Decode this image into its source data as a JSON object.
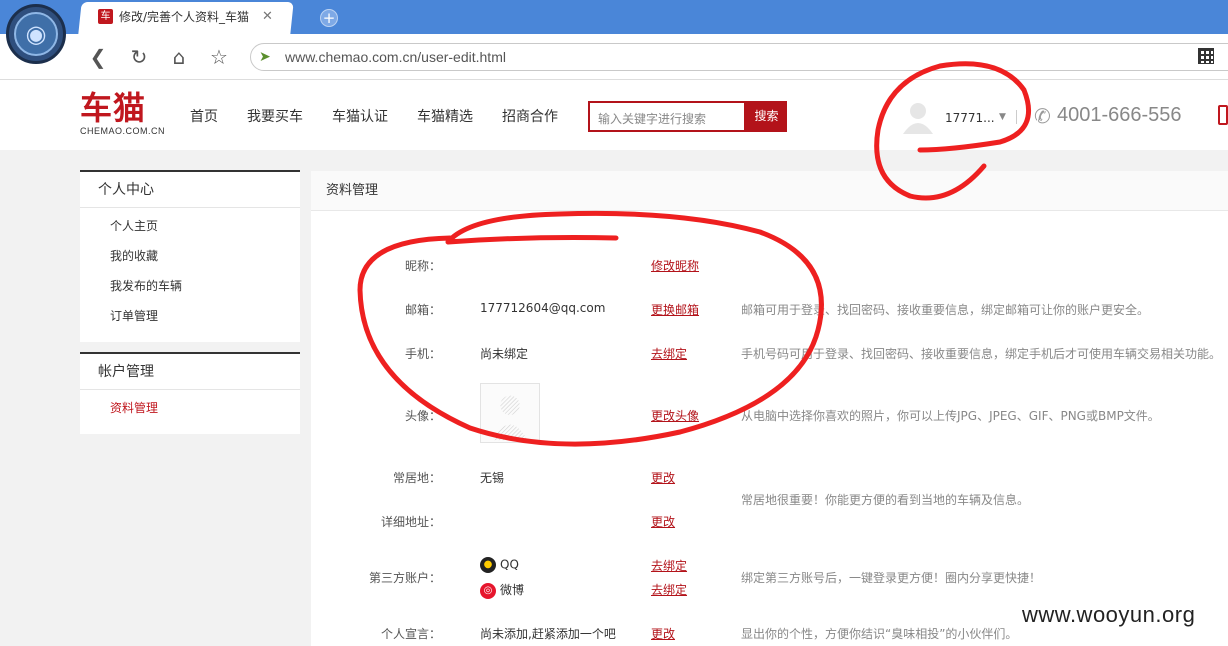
{
  "browser": {
    "tab_title": "修改/完善个人资料_车猫",
    "tab_favicon": "车",
    "url": "www.chemao.com.cn/user-edit.html",
    "icons": [
      "browser-logo-icon",
      "back-icon",
      "reload-icon",
      "home-icon",
      "bookmark-star-icon",
      "qr-code-icon"
    ]
  },
  "header": {
    "logo_cn": "车猫",
    "logo_en": "CHEMAO.COM.CN",
    "nav": [
      "首页",
      "我要买车",
      "车猫认证",
      "车猫精选",
      "招商合作"
    ],
    "search_placeholder": "输入关键字进行搜索",
    "search_button": "搜索",
    "username": "17771...",
    "phone": "4001-666-556"
  },
  "sidebar": {
    "sections": [
      {
        "title": "个人中心",
        "items": [
          "个人主页",
          "我的收藏",
          "我发布的车辆",
          "订单管理"
        ]
      },
      {
        "title": "帐户管理",
        "items": [
          "资料管理"
        ]
      }
    ]
  },
  "main": {
    "title": "资料管理",
    "rows": {
      "nickname": {
        "label": "昵称：",
        "value": "",
        "link": "修改昵称"
      },
      "email": {
        "label": "邮箱：",
        "value": "177712604@qq.com",
        "link": "更换邮箱",
        "hint": "邮箱可用于登录、找回密码、接收重要信息，绑定邮箱可让你的账户更安全。"
      },
      "phone": {
        "label": "手机：",
        "value": "尚未绑定",
        "link": "去绑定",
        "hint": "手机号码可用于登录、找回密码、接收重要信息，绑定手机后才可使用车辆交易相关功能。"
      },
      "avatar": {
        "label": "头像：",
        "link": "更改头像",
        "hint": "从电脑中选择你喜欢的照片，你可以上传JPG、JPEG、GIF、PNG或BMP文件。"
      },
      "residence": {
        "label": "常居地：",
        "value": "无锡",
        "link": "更改"
      },
      "address": {
        "label": "详细地址：",
        "value": "",
        "link": "更改",
        "hint": "常居地很重要！你能更方便的看到当地的车辆及信息。"
      },
      "third_party": {
        "label": "第三方账户：",
        "qq": "QQ",
        "qq_link": "去绑定",
        "weibo": "微博",
        "weibo_link": "去绑定",
        "hint": "绑定第三方账号后，一键登录更方便！圈内分享更快捷！"
      },
      "motto": {
        "label": "个人宣言：",
        "value": "尚未添加,赶紧添加一个吧",
        "link": "更改",
        "hint": "显出你的个性，方便你结识“臭味相投”的小伙伴们。"
      }
    }
  },
  "watermark": "www.wooyun.org",
  "annotation_color": "#ee2020"
}
